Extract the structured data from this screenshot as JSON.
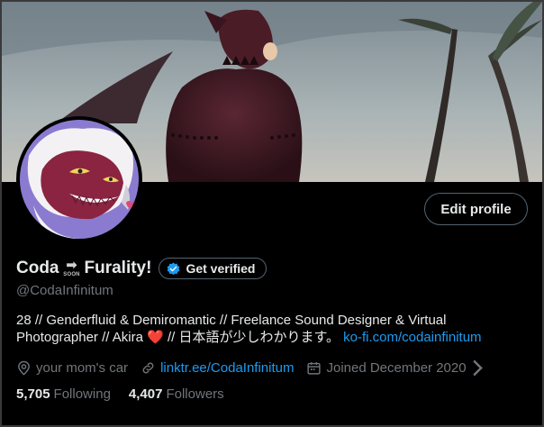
{
  "profile": {
    "name_part1": "Coda",
    "name_emoji_text": "SOON",
    "name_part2": "Furality!",
    "handle": "@CodaInfinitum",
    "get_verified_label": "Get verified",
    "edit_profile_label": "Edit profile"
  },
  "bio": {
    "line1": "28 // Genderfluid & Demiromantic // Freelance Sound Designer & Virtual",
    "line2_prefix": "Photographer // Akira",
    "heart": "❤️",
    "line2_middle": "// 日本語が少しわかります。",
    "link": "ko-fi.com/codainfinitum"
  },
  "meta": {
    "location": "your mom's car",
    "website": "linktr.ee/CodaInfinitum",
    "joined": "Joined December 2020"
  },
  "stats": {
    "following_count": "5,705",
    "following_label": "Following",
    "followers_count": "4,407",
    "followers_label": "Followers"
  },
  "colors": {
    "background": "#000000",
    "link": "#1d9bf0",
    "muted": "#71767b",
    "text": "#e7e9ea",
    "verified_badge": "#1d9bf0"
  },
  "icons": [
    "location-pin-icon",
    "link-icon",
    "calendar-icon",
    "chevron-right-icon",
    "verified-badge-icon",
    "soon-arrow-emoji"
  ]
}
